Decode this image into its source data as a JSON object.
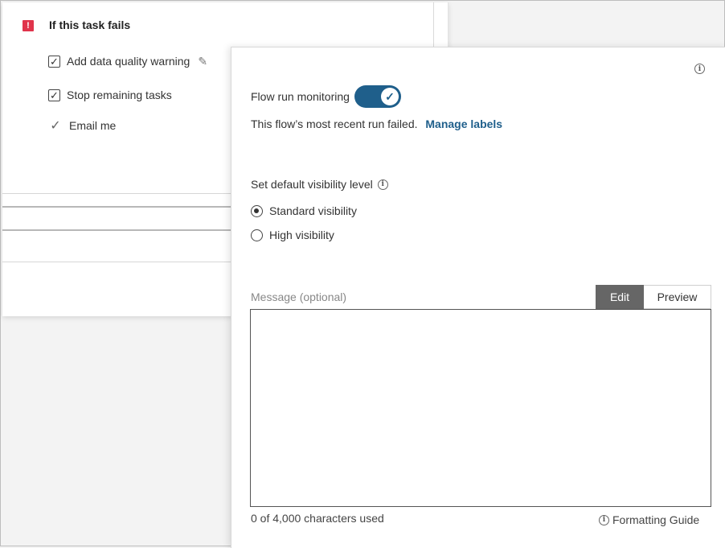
{
  "task": {
    "fail_badge": "!",
    "title": "If this task fails",
    "options": [
      {
        "label": "Add data quality warning",
        "checked": true
      },
      {
        "label": "Stop remaining tasks",
        "checked": true
      },
      {
        "label": "Email me",
        "checked": true
      }
    ],
    "check_glyph": "✓",
    "pencil_glyph": "✎"
  },
  "panel": {
    "info_glyph": "i",
    "monitoring_label": "Flow run monitoring",
    "monitoring_on": true,
    "toggle_glyph": "✓",
    "status_text": "This flow’s most recent run failed.",
    "manage_link": "Manage labels",
    "visibility_label": "Set default visibility level",
    "visibility_options": [
      {
        "label": "Standard visibility",
        "selected": true
      },
      {
        "label": "High visibility",
        "selected": false
      }
    ],
    "message_label": "Message (optional)",
    "message_value": "",
    "tabs": {
      "edit": "Edit",
      "preview": "Preview",
      "active": "edit"
    },
    "char_count": "0 of 4,000 characters used",
    "formatting_guide": "Formatting Guide"
  },
  "colors": {
    "accent": "#1f5f8b",
    "fail_red": "#e0344b",
    "active_tab": "#666666"
  }
}
